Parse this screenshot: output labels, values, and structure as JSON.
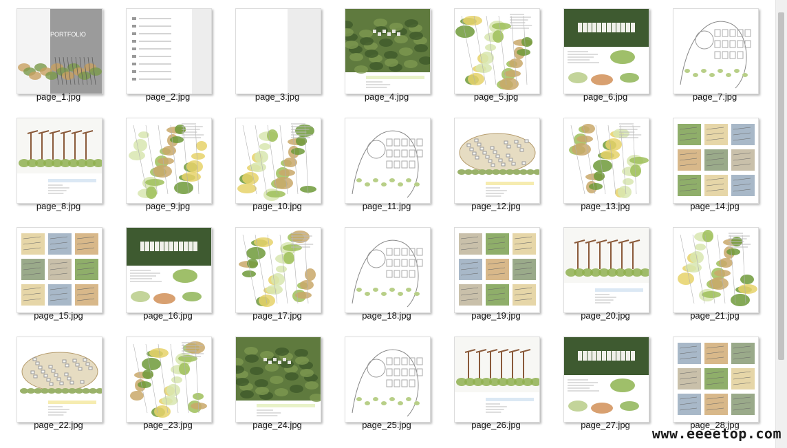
{
  "files": [
    {
      "name": "page_1.jpg",
      "style": "cover",
      "label": "PORTFOLIO"
    },
    {
      "name": "page_2.jpg",
      "style": "toc"
    },
    {
      "name": "page_3.jpg",
      "style": "blank"
    },
    {
      "name": "page_4.jpg",
      "style": "photo"
    },
    {
      "name": "page_5.jpg",
      "style": "plan"
    },
    {
      "name": "page_6.jpg",
      "style": "photo2"
    },
    {
      "name": "page_7.jpg",
      "style": "lineplan"
    },
    {
      "name": "page_8.jpg",
      "style": "perspective"
    },
    {
      "name": "page_9.jpg",
      "style": "plan"
    },
    {
      "name": "page_10.jpg",
      "style": "plan"
    },
    {
      "name": "page_11.jpg",
      "style": "lineplan"
    },
    {
      "name": "page_12.jpg",
      "style": "aerial"
    },
    {
      "name": "page_13.jpg",
      "style": "plan"
    },
    {
      "name": "page_14.jpg",
      "style": "collage"
    },
    {
      "name": "page_15.jpg",
      "style": "collage"
    },
    {
      "name": "page_16.jpg",
      "style": "photo2"
    },
    {
      "name": "page_17.jpg",
      "style": "plan"
    },
    {
      "name": "page_18.jpg",
      "style": "lineplan"
    },
    {
      "name": "page_19.jpg",
      "style": "collage"
    },
    {
      "name": "page_20.jpg",
      "style": "perspective"
    },
    {
      "name": "page_21.jpg",
      "style": "plan"
    },
    {
      "name": "page_22.jpg",
      "style": "aerial"
    },
    {
      "name": "page_23.jpg",
      "style": "plan"
    },
    {
      "name": "page_24.jpg",
      "style": "photo"
    },
    {
      "name": "page_25.jpg",
      "style": "lineplan"
    },
    {
      "name": "page_26.jpg",
      "style": "perspective"
    },
    {
      "name": "page_27.jpg",
      "style": "photo2"
    },
    {
      "name": "page_28.jpg",
      "style": "collage"
    }
  ],
  "watermark": "www.eeeetop.com"
}
